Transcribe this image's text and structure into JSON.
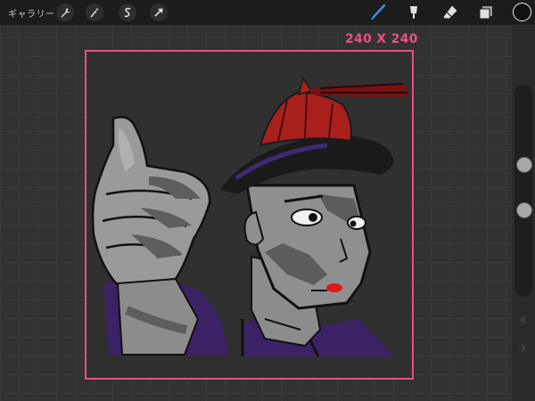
{
  "toolbar": {
    "gallery_label": "ギャラリー",
    "left_tools": [
      "wrench-icon",
      "magic-wand-icon",
      "selection-icon",
      "transform-arrow-icon"
    ],
    "right_tools": [
      "brush-icon",
      "smudge-icon",
      "eraser-icon",
      "layers-icon"
    ],
    "active_tool_color": "#3b8ff0",
    "current_color": "#111111"
  },
  "canvas": {
    "size_label": "240 X 240",
    "frame_color": "#e74f86"
  },
  "sidebar": {
    "brush_size_level": 0.34,
    "opacity_level": 0.58,
    "undo_icon": "undo-icon",
    "redo_icon": "redo-icon"
  }
}
